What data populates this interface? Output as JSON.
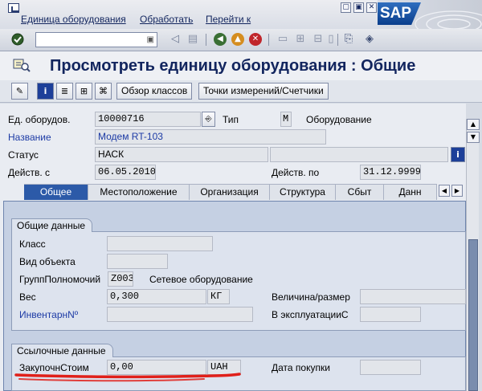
{
  "menu": {
    "items": [
      "Единица оборудования",
      "Обработать",
      "Перейти к"
    ]
  },
  "window": {
    "minimize": "▢",
    "maximize": "▣",
    "close": "✕"
  },
  "brand": {
    "logo": "SAP"
  },
  "title": "Просмотреть единицу оборудования : Общие",
  "toolbar": {
    "class_overview": "Обзор классов",
    "measuring_points": "Точки измерений/Счетчики"
  },
  "header": {
    "equipment_label": "Ед. оборудов.",
    "equipment_value": "10000716",
    "type_label": "Тип",
    "type_value": "M",
    "type_text": "Оборудование",
    "name_label": "Название",
    "name_value": "Модем RT-103",
    "status_label": "Статус",
    "status_value": "НАСК",
    "valid_from_label": "Действ. с",
    "valid_from_value": "06.05.2010",
    "valid_to_label": "Действ. по",
    "valid_to_value": "31.12.9999"
  },
  "tabs": [
    "Общее",
    "Местоположение",
    "Организация",
    "Структура",
    "Сбыт",
    "Данн"
  ],
  "general_data": {
    "title": "Общие данные",
    "class_label": "Класс",
    "object_type_label": "Вид объекта",
    "auth_group_label": "ГруппПолномочий",
    "auth_group_value": "Z003",
    "auth_group_text": "Сетевое оборудование",
    "weight_label": "Вес",
    "weight_value": "0,300",
    "weight_unit": "КГ",
    "size_label": "Величина/размер",
    "inventory_label": "ИнвентарнNº",
    "startup_label": "В эксплуатацииС"
  },
  "reference_data": {
    "title": "Ссылочные данные",
    "acq_value_label": "ЗакупочнСтоим",
    "acq_value": "0,00",
    "currency": "UAH",
    "acq_date_label": "Дата покупки"
  },
  "colors": {
    "title_blue": "#12255e",
    "link_blue": "#1c3aa5",
    "tab_active": "#2c5aa8",
    "annotation_red": "#e0201a"
  }
}
